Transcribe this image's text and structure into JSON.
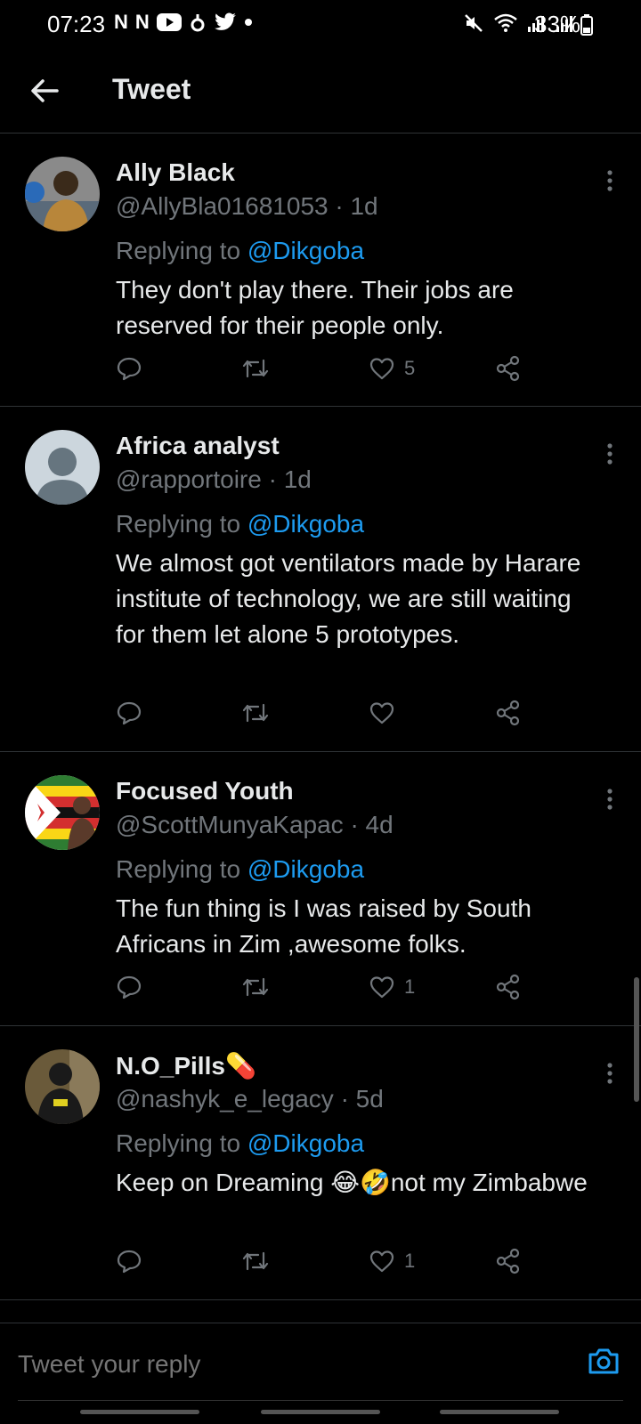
{
  "status_bar": {
    "time": "07:23",
    "battery": "33%",
    "left_icons": [
      "N",
      "N"
    ]
  },
  "header": {
    "title": "Tweet"
  },
  "tweets": [
    {
      "name": "Ally Black",
      "handle": "@AllyBla01681053 · 1d",
      "replying_label": "Replying to",
      "mention": "@Dikgoba",
      "text": "They don't play there. Their jobs are reserved for their people only.",
      "likes": "5",
      "avatar_color": "#6b4a2a"
    },
    {
      "name": "Africa analyst",
      "handle": "@rapportoire · 1d",
      "replying_label": "Replying to",
      "mention": "@Dikgoba",
      "text": "We almost got ventilators made by Harare institute of technology, we are still waiting for them let alone 5 prototypes.",
      "likes": "",
      "avatar_color": "#ccd6dd"
    },
    {
      "name": "Focused Youth",
      "handle": "@ScottMunyaKapac · 4d",
      "replying_label": "Replying to",
      "mention": "@Dikgoba",
      "text": "The fun thing is I was raised by South Africans in Zim ,awesome folks.",
      "likes": "1",
      "avatar_color": "#2e7d32"
    },
    {
      "name": "N.O_Pills💊",
      "handle": "@nashyk_e_legacy · 5d",
      "replying_label": "Replying to",
      "mention": "@Dikgoba",
      "text": "Keep on Dreaming 😂🤣not my Zimbabwe",
      "likes": "1",
      "avatar_color": "#3b3b2a"
    }
  ],
  "reply": {
    "placeholder": "Tweet your reply"
  },
  "colors": {
    "background": "#000000",
    "accent": "#1d9bf0",
    "muted": "#71767b",
    "text": "#e7e9ea"
  }
}
